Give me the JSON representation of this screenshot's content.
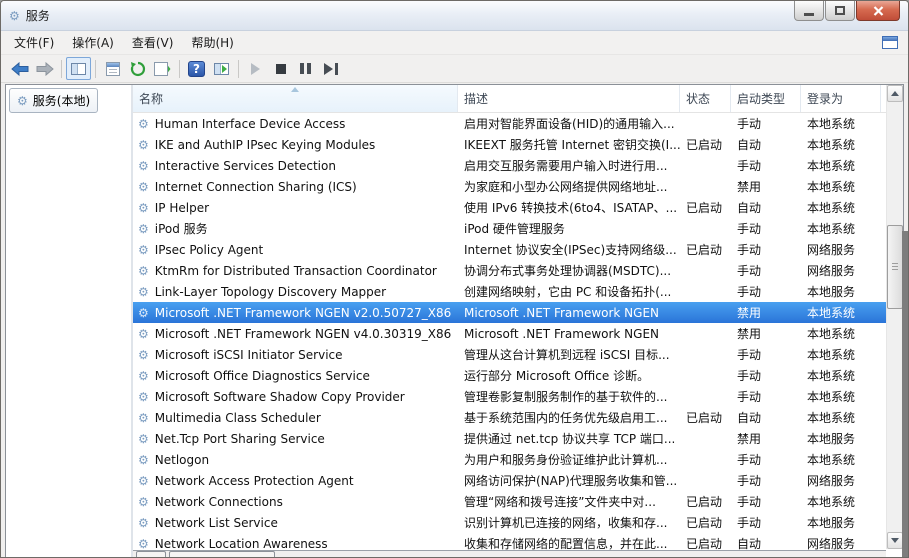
{
  "window": {
    "title": "服务"
  },
  "icons": {
    "gear": "⚙",
    "help": "?"
  },
  "menubar": {
    "items": [
      "文件(F)",
      "操作(A)",
      "查看(V)",
      "帮助(H)"
    ]
  },
  "toolbar": {
    "buttons": [
      "back",
      "forward",
      "show-console-tree",
      "properties",
      "refresh",
      "export-list",
      "help",
      "extended-view",
      "start-service",
      "stop-service",
      "pause-service",
      "restart-service"
    ]
  },
  "sidebar": {
    "items": [
      {
        "label": "服务(本地)",
        "selected": true
      }
    ]
  },
  "table": {
    "columns": [
      {
        "id": "name",
        "label": "名称",
        "sorted": true
      },
      {
        "id": "desc",
        "label": "描述"
      },
      {
        "id": "status",
        "label": "状态"
      },
      {
        "id": "startup",
        "label": "启动类型"
      },
      {
        "id": "logon",
        "label": "登录为"
      }
    ],
    "rows": [
      {
        "name": "Human Interface Device Access",
        "description": "启用对智能界面设备(HID)的通用输入...",
        "status": "",
        "startup_type": "手动",
        "logon_as": "本地系统",
        "selected": false
      },
      {
        "name": "IKE and AuthIP IPsec Keying Modules",
        "description": "IKEEXT 服务托管 Internet 密钥交换(I...",
        "status": "已启动",
        "startup_type": "自动",
        "logon_as": "本地系统",
        "selected": false
      },
      {
        "name": "Interactive Services Detection",
        "description": "启用交互服务需要用户输入时进行用...",
        "status": "",
        "startup_type": "手动",
        "logon_as": "本地系统",
        "selected": false
      },
      {
        "name": "Internet Connection Sharing (ICS)",
        "description": "为家庭和小型办公网络提供网络地址...",
        "status": "",
        "startup_type": "禁用",
        "logon_as": "本地系统",
        "selected": false
      },
      {
        "name": "IP Helper",
        "description": "使用 IPv6 转换技术(6to4、ISATAP、...",
        "status": "已启动",
        "startup_type": "自动",
        "logon_as": "本地系统",
        "selected": false
      },
      {
        "name": "iPod 服务",
        "description": "iPod 硬件管理服务",
        "status": "",
        "startup_type": "手动",
        "logon_as": "本地系统",
        "selected": false
      },
      {
        "name": "IPsec Policy Agent",
        "description": "Internet 协议安全(IPSec)支持网络级...",
        "status": "已启动",
        "startup_type": "手动",
        "logon_as": "网络服务",
        "selected": false
      },
      {
        "name": "KtmRm for Distributed Transaction Coordinator",
        "description": "协调分布式事务处理协调器(MSDTC)...",
        "status": "",
        "startup_type": "手动",
        "logon_as": "网络服务",
        "selected": false
      },
      {
        "name": "Link-Layer Topology Discovery Mapper",
        "description": "创建网络映射，它由 PC 和设备拓扑(...",
        "status": "",
        "startup_type": "手动",
        "logon_as": "本地服务",
        "selected": false
      },
      {
        "name": "Microsoft .NET Framework NGEN v2.0.50727_X86",
        "description": "Microsoft .NET Framework NGEN",
        "status": "",
        "startup_type": "禁用",
        "logon_as": "本地系统",
        "selected": true
      },
      {
        "name": "Microsoft .NET Framework NGEN v4.0.30319_X86",
        "description": "Microsoft .NET Framework NGEN",
        "status": "",
        "startup_type": "禁用",
        "logon_as": "本地系统",
        "selected": false
      },
      {
        "name": "Microsoft iSCSI Initiator Service",
        "description": "管理从这台计算机到远程 iSCSI 目标...",
        "status": "",
        "startup_type": "手动",
        "logon_as": "本地系统",
        "selected": false
      },
      {
        "name": "Microsoft Office Diagnostics Service",
        "description": "运行部分 Microsoft Office 诊断。",
        "status": "",
        "startup_type": "手动",
        "logon_as": "本地系统",
        "selected": false
      },
      {
        "name": "Microsoft Software Shadow Copy Provider",
        "description": "管理卷影复制服务制作的基于软件的...",
        "status": "",
        "startup_type": "手动",
        "logon_as": "本地系统",
        "selected": false
      },
      {
        "name": "Multimedia Class Scheduler",
        "description": "基于系统范围内的任务优先级启用工...",
        "status": "已启动",
        "startup_type": "自动",
        "logon_as": "本地系统",
        "selected": false
      },
      {
        "name": "Net.Tcp Port Sharing Service",
        "description": "提供通过 net.tcp 协议共享 TCP 端口...",
        "status": "",
        "startup_type": "禁用",
        "logon_as": "本地服务",
        "selected": false
      },
      {
        "name": "Netlogon",
        "description": "为用户和服务身份验证维护此计算机...",
        "status": "",
        "startup_type": "手动",
        "logon_as": "本地系统",
        "selected": false
      },
      {
        "name": "Network Access Protection Agent",
        "description": "网络访问保护(NAP)代理服务收集和管...",
        "status": "",
        "startup_type": "手动",
        "logon_as": "网络服务",
        "selected": false
      },
      {
        "name": "Network Connections",
        "description": "管理“网络和拨号连接”文件夹中对...",
        "status": "已启动",
        "startup_type": "手动",
        "logon_as": "本地系统",
        "selected": false
      },
      {
        "name": "Network List Service",
        "description": "识别计算机已连接的网络，收集和存...",
        "status": "已启动",
        "startup_type": "手动",
        "logon_as": "本地服务",
        "selected": false
      },
      {
        "name": "Network Location Awareness",
        "description": "收集和存储网络的配置信息，并在此...",
        "status": "已启动",
        "startup_type": "自动",
        "logon_as": "网络服务",
        "selected": false
      }
    ]
  },
  "colors": {
    "selection_top": "#49a0f0",
    "selection_bottom": "#2a74d8",
    "close_button": "#c04d38",
    "header_sorted": "#e7f2fb"
  }
}
